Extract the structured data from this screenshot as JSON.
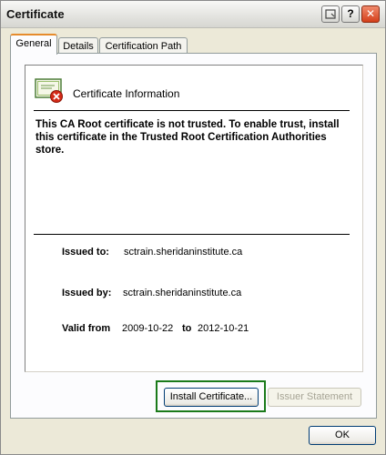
{
  "window": {
    "title": "Certificate"
  },
  "title_buttons": {
    "help": "?",
    "close": "✕"
  },
  "tabs": [
    {
      "label": "General"
    },
    {
      "label": "Details"
    },
    {
      "label": "Certification Path"
    }
  ],
  "info": {
    "title": "Certificate Information",
    "message": "This CA Root certificate is not trusted. To enable trust, install this certificate in the Trusted Root Certification Authorities store."
  },
  "details": {
    "issued_to_label": "Issued to:",
    "issued_to_value": "sctrain.sheridaninstitute.ca",
    "issued_by_label": "Issued by:",
    "issued_by_value": "sctrain.sheridaninstitute.ca",
    "valid_from_label": "Valid from",
    "valid_from_value": "2009-10-22",
    "valid_to_label": "to",
    "valid_to_value": "2012-10-21"
  },
  "buttons": {
    "install": "Install Certificate...",
    "issuer_statement": "Issuer Statement",
    "ok": "OK"
  },
  "colors": {
    "accent_tab": "#e68b2c",
    "focus_highlight": "#1a7a1a",
    "close_button": "#d4401b"
  }
}
